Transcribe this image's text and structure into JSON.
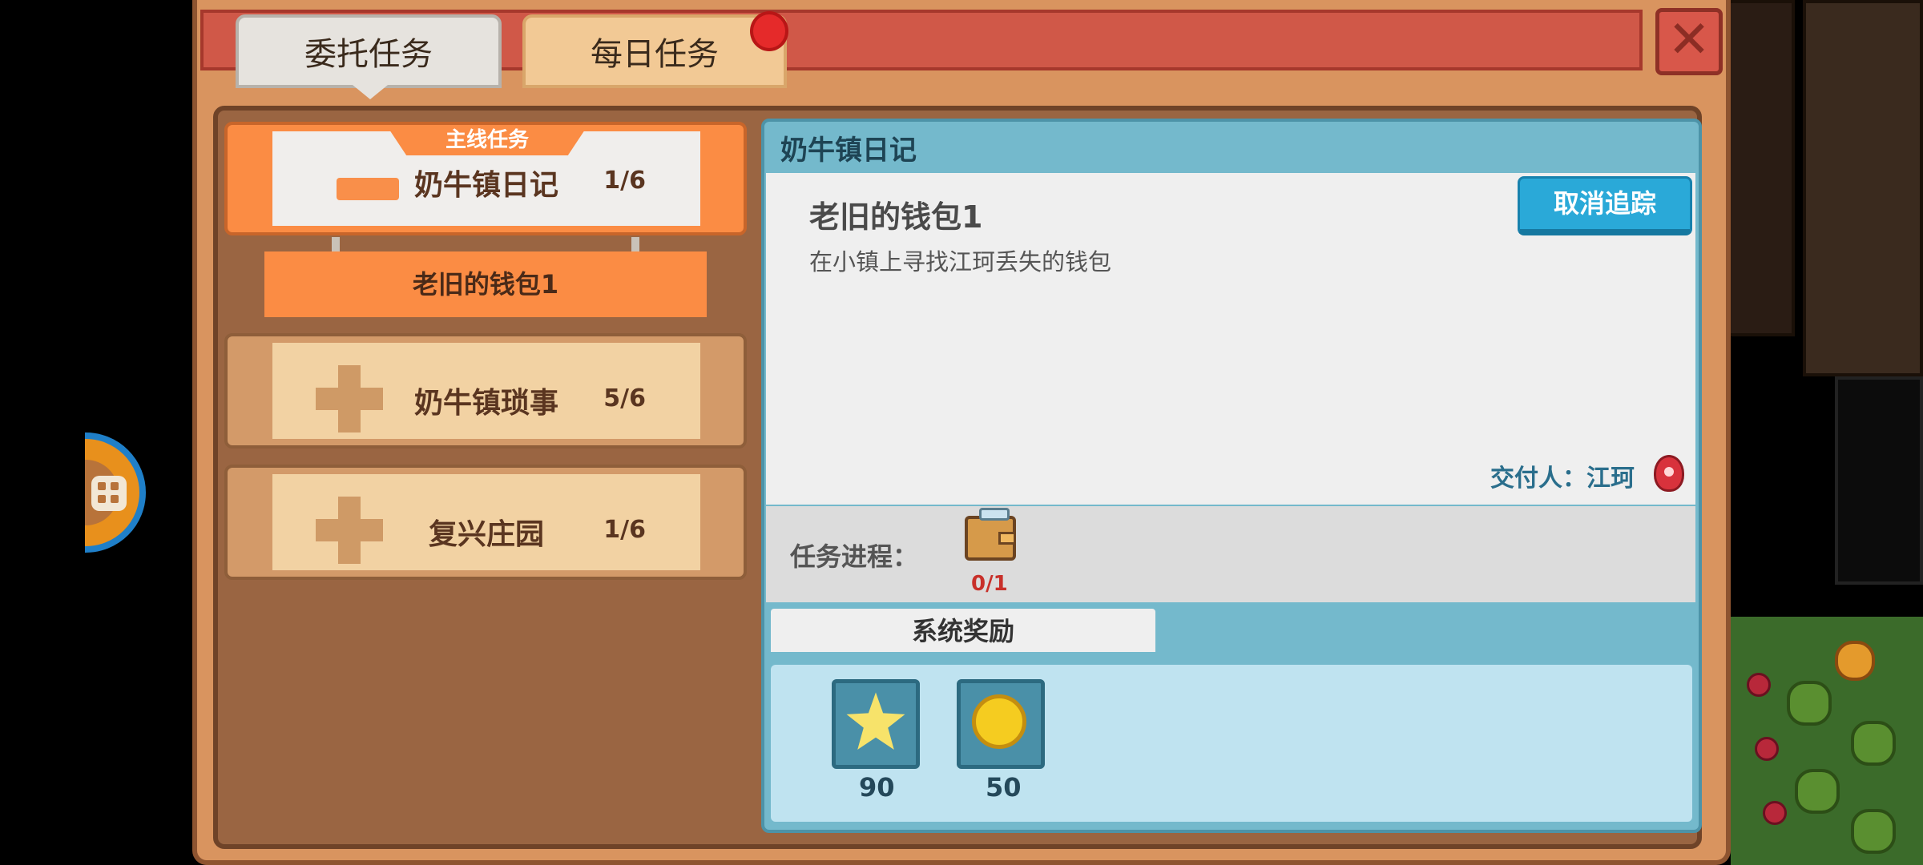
{
  "tabs": [
    {
      "label": "委托任务",
      "selected": true
    },
    {
      "label": "每日任务",
      "selected": false,
      "has_badge": true
    }
  ],
  "close_icon": "close-icon",
  "quest_list": {
    "main_tag": "主线任务",
    "categories": [
      {
        "name": "奶牛镇日记",
        "count": "1/6",
        "expanded": true
      },
      {
        "name": "奶牛镇琐事",
        "count": "5/6",
        "expanded": false
      },
      {
        "name": "复兴庄园",
        "count": "1/6",
        "expanded": false
      }
    ],
    "selected_quest": "老旧的钱包1"
  },
  "detail": {
    "category_title": "奶牛镇日记",
    "quest_name": "老旧的钱包1",
    "description": "在小镇上寻找江珂丢失的钱包",
    "untrack_label": "取消追踪",
    "giver_label": "交付人：江珂",
    "progress_label": "任务进程：",
    "progress_item_icon": "wallet-icon",
    "progress_count": "0/1",
    "rewards_tab": "系统奖励",
    "rewards": [
      {
        "icon": "star-icon",
        "amount": "90"
      },
      {
        "icon": "gold-coin-icon",
        "amount": "50"
      }
    ]
  },
  "colors": {
    "accent_orange": "#fb8c44",
    "header_red": "#d05848",
    "detail_blue": "#74b9cc",
    "button_blue": "#2aa9d8"
  }
}
